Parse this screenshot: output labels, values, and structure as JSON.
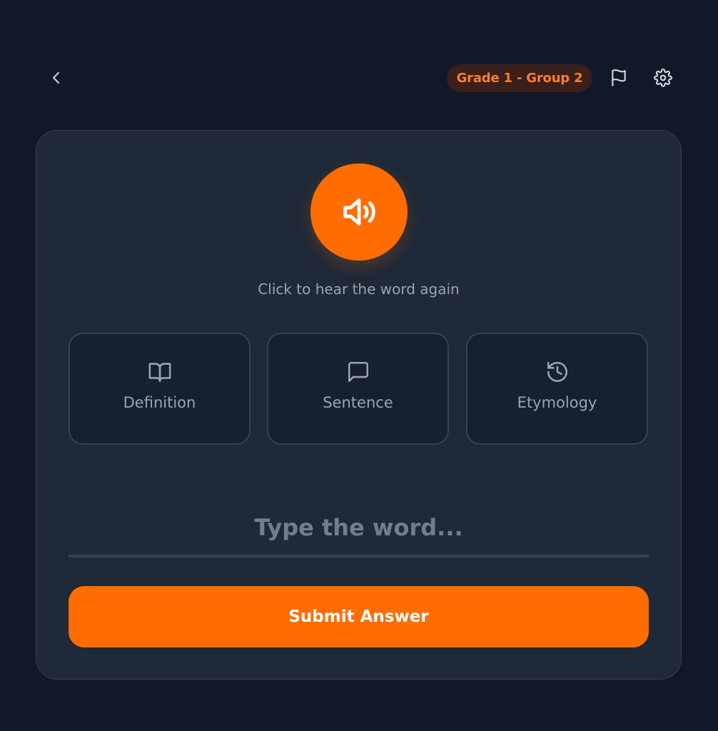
{
  "header": {
    "back_icon": "chevron-left-icon",
    "badge_label": "Grade 1 - Group 2",
    "flag_icon": "flag-icon",
    "settings_icon": "gear-icon"
  },
  "card": {
    "speaker_icon": "speaker-volume-icon",
    "hint": "Click to hear the word again",
    "clues": [
      {
        "label": "Definition",
        "icon": "book-open-icon"
      },
      {
        "label": "Sentence",
        "icon": "message-square-icon"
      },
      {
        "label": "Etymology",
        "icon": "history-icon"
      }
    ],
    "answer_placeholder": "Type the word...",
    "answer_value": "",
    "submit_label": "Submit Answer"
  },
  "colors": {
    "background": "#111827",
    "card": "#1f2937",
    "accent": "#ff6d00",
    "badge_bg": "#3a1f1b",
    "badge_text": "#fb7f2a",
    "muted_text": "#9ca3af"
  }
}
